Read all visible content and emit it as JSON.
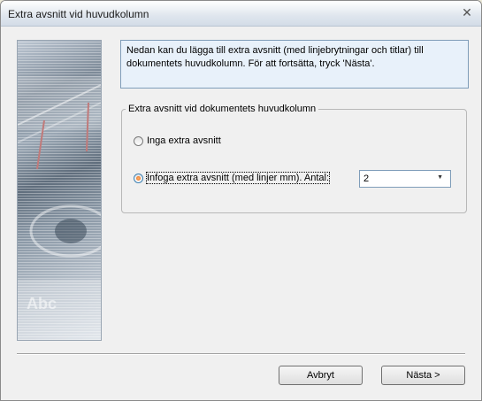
{
  "window": {
    "title": "Extra avsnitt vid huvudkolumn",
    "close_glyph": "✕"
  },
  "side_image": {
    "text": "Abc"
  },
  "info": {
    "text": "Nedan kan du lägga till extra avsnitt (med linjebrytningar och titlar) till dokumentets huvudkolumn. För att fortsätta, tryck 'Nästa'."
  },
  "group": {
    "legend": "Extra avsnitt vid dokumentets huvudkolumn",
    "options": [
      {
        "label": "Inga extra avsnitt",
        "selected": false
      },
      {
        "label": "Infoga extra avsnitt (med linjer mm). Antal:",
        "selected": true
      }
    ],
    "count_select": {
      "value": "2"
    }
  },
  "buttons": {
    "cancel_label": "Avbryt",
    "next_label": "Nästa >"
  },
  "colors": {
    "info_bg": "#e8f1fa",
    "selected_radio": "#e5681a"
  }
}
